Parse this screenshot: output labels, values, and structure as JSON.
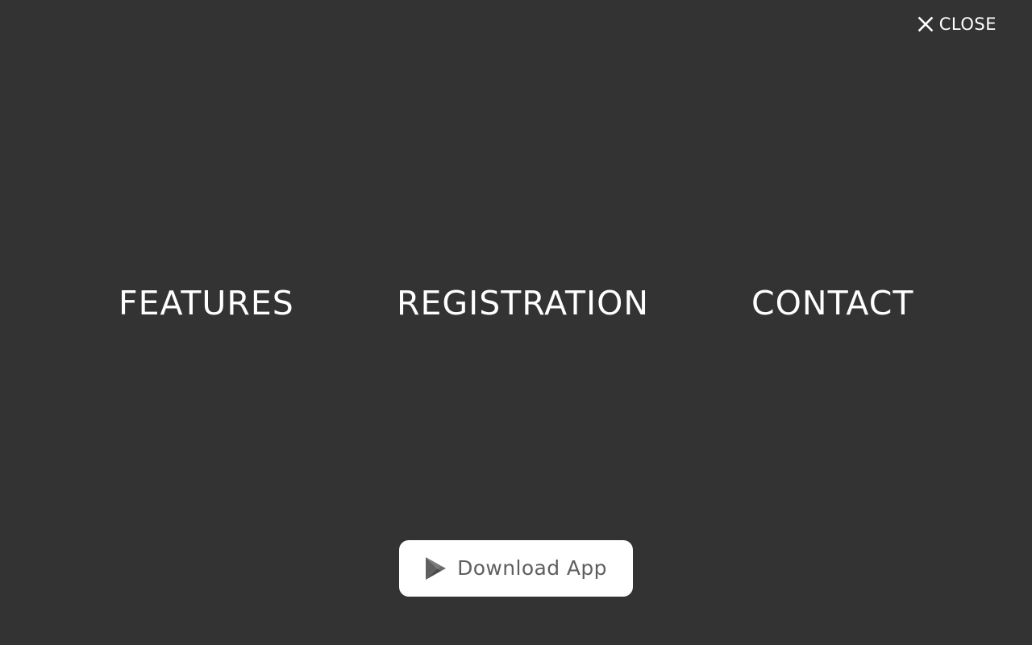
{
  "header": {
    "close_label": "CLOSE",
    "close_icon": "close-icon"
  },
  "nav": {
    "items": [
      {
        "label": "FEATURES"
      },
      {
        "label": "REGISTRATION"
      },
      {
        "label": "CONTACT"
      }
    ]
  },
  "download": {
    "label": "Download App",
    "icon": "google-play-icon"
  },
  "colors": {
    "background": "#333333",
    "text": "#ffffff",
    "button_bg": "#ffffff",
    "button_text": "#5f5f5f"
  }
}
